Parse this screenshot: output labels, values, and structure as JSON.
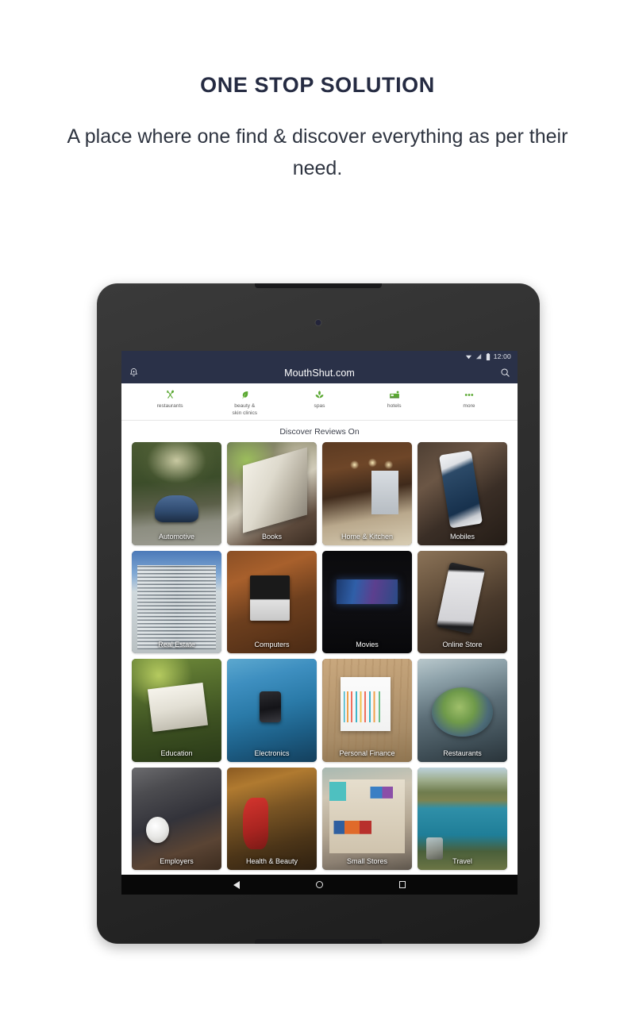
{
  "promo": {
    "title": "ONE STOP SOLUTION",
    "subtitle": "A place where one find & discover everything as per their need."
  },
  "device": {
    "type": "android-tablet",
    "frame_color": "#2f2f2f"
  },
  "statusbar": {
    "wifi_icon": "wifi-icon",
    "signal_icon": "signal-bars-icon",
    "battery_icon": "battery-icon",
    "clock": "12:00"
  },
  "appbar": {
    "title": "MouthShut.com",
    "background": "#2a3148",
    "notification_icon": "bell-icon",
    "search_icon": "search-icon"
  },
  "categories": [
    {
      "label": "restaurants",
      "icon": "fork-and-spoon-icon"
    },
    {
      "label": "beauty &\nskin clinics",
      "icon": "leaf-brush-icon"
    },
    {
      "label": "spas",
      "icon": "lotus-icon"
    },
    {
      "label": "hotels",
      "icon": "bed-icon"
    },
    {
      "label": "more",
      "icon": "more-dots-icon"
    }
  ],
  "grid": {
    "heading": "Discover Reviews On",
    "tiles": [
      {
        "label": "Automotive",
        "art": "art-automotive"
      },
      {
        "label": "Books",
        "art": "art-books"
      },
      {
        "label": "Home & Kitchen",
        "art": "art-homekitchen"
      },
      {
        "label": "Mobiles",
        "art": "art-mobiles"
      },
      {
        "label": "Real Estate",
        "art": "art-realestate"
      },
      {
        "label": "Computers",
        "art": "art-computers"
      },
      {
        "label": "Movies",
        "art": "art-movies"
      },
      {
        "label": "Online Store",
        "art": "art-onlinestore"
      },
      {
        "label": "Education",
        "art": "art-education"
      },
      {
        "label": "Electronics",
        "art": "art-electronics"
      },
      {
        "label": "Personal Finance",
        "art": "art-personalfinance"
      },
      {
        "label": "Restaurants",
        "art": "art-restaurants"
      },
      {
        "label": "Employers",
        "art": "art-employers"
      },
      {
        "label": "Health & Beauty",
        "art": "art-healthbeauty"
      },
      {
        "label": "Small Stores",
        "art": "art-smallstores"
      },
      {
        "label": "Travel",
        "art": "art-travel"
      }
    ]
  },
  "navbar": {
    "back_icon": "back-triangle-icon",
    "home_icon": "home-circle-icon",
    "recents_icon": "recents-square-icon"
  },
  "colors": {
    "accent_green": "#5aa832",
    "appbar_navy": "#2a3148",
    "heading_dark": "#252b42"
  }
}
